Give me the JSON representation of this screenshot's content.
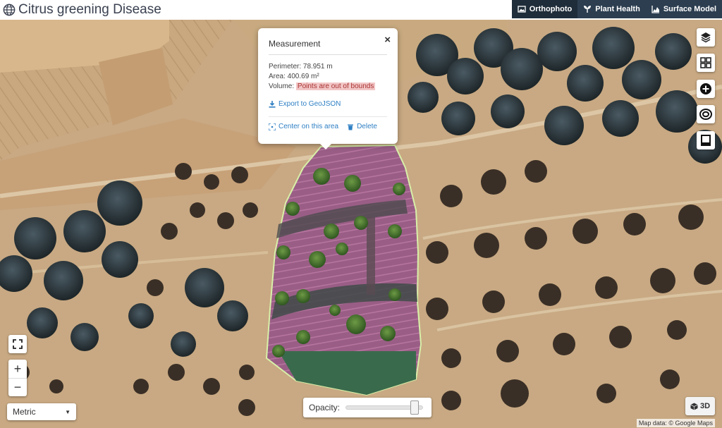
{
  "header": {
    "title": "Citrus greening Disease",
    "tabs": [
      {
        "label": "Orthophoto",
        "icon": "image-icon",
        "active": true
      },
      {
        "label": "Plant Health",
        "icon": "plant-icon",
        "active": false
      },
      {
        "label": "Surface Model",
        "icon": "chart-icon",
        "active": false
      }
    ]
  },
  "popup": {
    "title": "Measurement",
    "close": "×",
    "perimeter": "Perimeter: 78.951 m",
    "area": "Area: 400.69 m²",
    "volume_label": "Volume:",
    "volume_value": "Points are out of bounds",
    "export": "Export to GeoJSON",
    "center": "Center on this area",
    "delete": "Delete"
  },
  "controls": {
    "zoom_in": "+",
    "zoom_out": "−",
    "units": "Metric",
    "opacity_label": "Opacity:",
    "opacity_value": 0.95,
    "btn_3d": "3D",
    "toolbar_icons": [
      "layers-icon",
      "grid-icon",
      "add-circle-icon",
      "ring-icon",
      "square-icon"
    ],
    "fullscreen_icon": "fullscreen-icon"
  },
  "attribution": "Map data: © Google Maps",
  "colors": {
    "header_tab_bg": "#2c3e50",
    "active_tab_bg": "#1f2d3a",
    "link": "#2e7fc3",
    "warning_bg": "#f2c6c6",
    "polygon_stroke": "#d8f0a8"
  }
}
